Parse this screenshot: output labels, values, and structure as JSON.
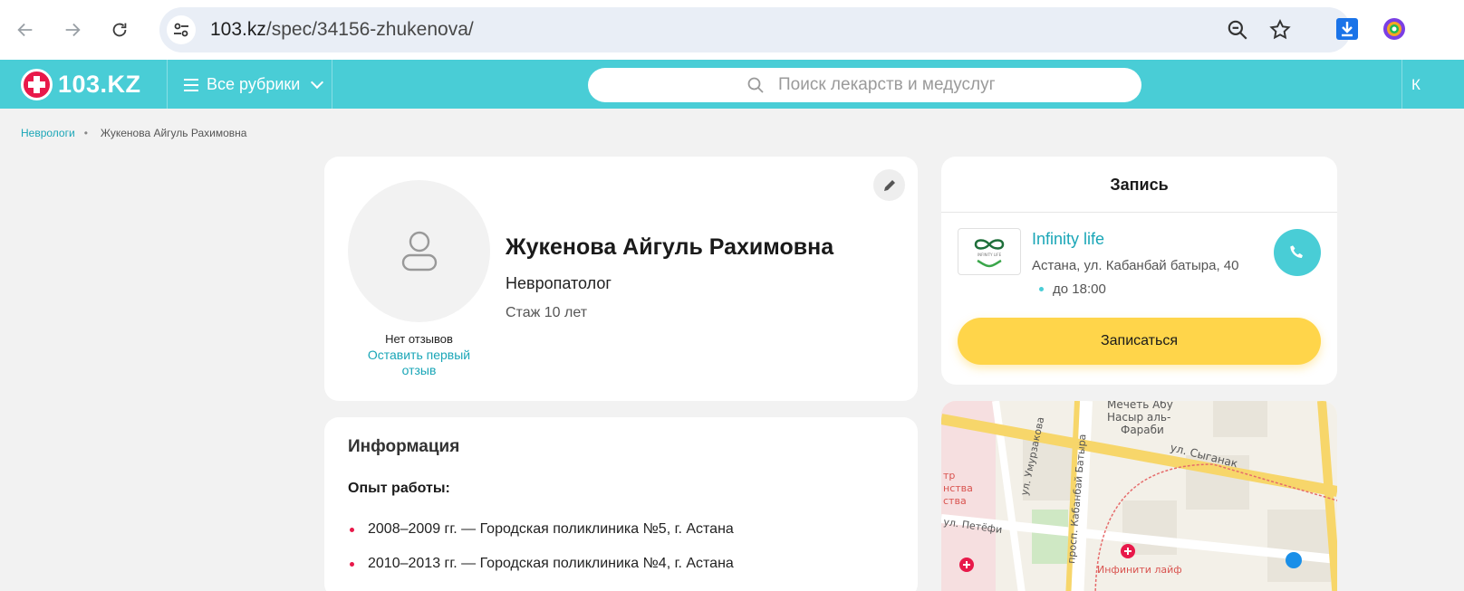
{
  "browser": {
    "url_host": "103.kz",
    "url_path": "/spec/34156-zhukenova/"
  },
  "site": {
    "logo_text": "103.KZ",
    "rubrics_label": "Все рубрики",
    "search_placeholder": "Поиск лекарств и медуслуг",
    "header_right_text": "К"
  },
  "breadcrumb": {
    "items": [
      {
        "label": "Неврологи"
      },
      {
        "label": "Жукенова Айгуль Рахимовна"
      }
    ]
  },
  "profile": {
    "name": "Жукенова Айгуль Рахимовна",
    "specialty": "Невропатолог",
    "experience": "Стаж 10 лет",
    "no_reviews": "Нет отзывов",
    "leave_review": "Оставить первый отзыв"
  },
  "info": {
    "title": "Информация",
    "experience_title": "Опыт работы:",
    "experience_items": [
      "2008–2009 гг. — Городская поликлиника №5, г. Астана",
      "2010–2013 гг. — Городская поликлиника №4, г. Астана"
    ]
  },
  "booking": {
    "title": "Запись",
    "clinic_name": "Infinity life",
    "clinic_address": "Астана, ул. Кабанбай батыра, 40",
    "clinic_hours": "до 18:00",
    "book_label": "Записаться",
    "clinic_logo_text": "INFINITY LIFE"
  },
  "map": {
    "labels": {
      "mosque_1": "Мечеть Абу",
      "mosque_2": "Насыр аль-",
      "mosque_3": "Фараби",
      "street_syganak": "ул. Сыганак",
      "street_umurzakova": "ул. Умурзакова",
      "street_kabanbai": "просп. Кабанбай Батыра",
      "street_petefi": "ул. Петёфи",
      "poi_left_1": "тр",
      "poi_left_2": "нства",
      "poi_left_3": "ства",
      "poi_infiniti": "Инфинити лайф"
    }
  },
  "colors": {
    "brand_teal": "#49cdd6",
    "brand_red": "#e8194a",
    "button_yellow": "#ffd54a",
    "link_teal": "#1aa6b7"
  }
}
